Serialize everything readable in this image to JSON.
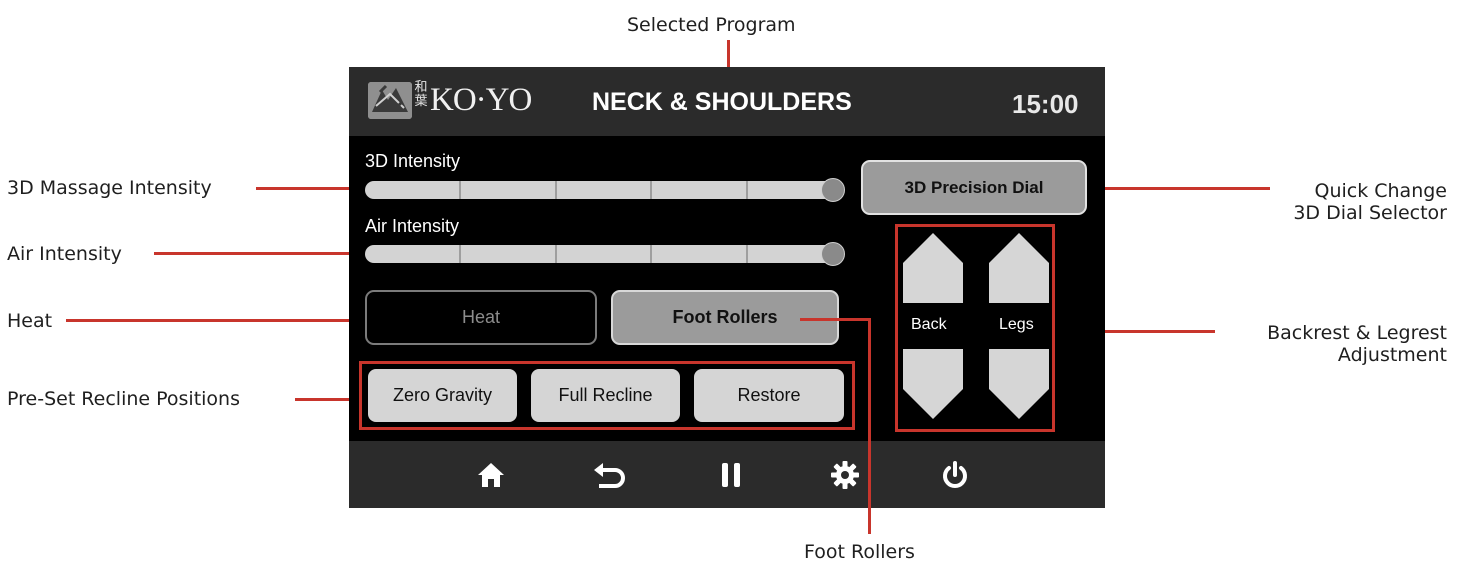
{
  "annotations": {
    "selected_program": "Selected Program",
    "massage_intensity": "3D Massage Intensity",
    "air_intensity": "Air Intensity",
    "heat": "Heat",
    "recline_positions": "Pre-Set Recline Positions",
    "quick_change_line1": "Quick Change",
    "quick_change_line2": "3D Dial Selector",
    "backrest_line1": "Backrest & Legrest",
    "backrest_line2": "Adjustment",
    "foot_rollers": "Foot Rollers"
  },
  "header": {
    "logo_text": "KO·YO",
    "logo_kanji": "和\n葉",
    "program_title": "NECK & SHOULDERS",
    "timer": "15:00"
  },
  "sliders": {
    "intensity_3d": {
      "label": "3D Intensity",
      "level": 1.0,
      "ticks": 5
    },
    "air": {
      "label": "Air Intensity",
      "level": 1.0,
      "ticks": 5
    }
  },
  "buttons": {
    "heat": "Heat",
    "foot_rollers": "Foot Rollers",
    "precision_dial": "3D Precision Dial",
    "zero_gravity": "Zero Gravity",
    "full_recline": "Full Recline",
    "restore": "Restore"
  },
  "adjust": {
    "back": "Back",
    "legs": "Legs"
  },
  "nav": [
    "home-icon",
    "back-icon",
    "pause-icon",
    "settings-icon",
    "power-icon"
  ],
  "colors": {
    "accent_red": "#c8352c",
    "bar_gray": "#2b2b2b",
    "button_gray": "#9b9b9b",
    "button_light": "#d5d5d5"
  }
}
